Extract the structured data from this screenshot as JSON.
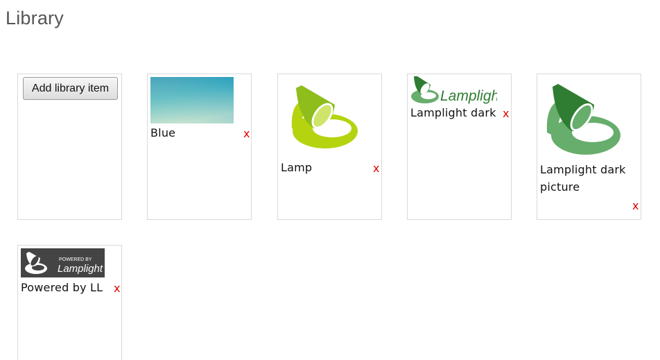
{
  "title": "Library",
  "add_button_label": "Add library item",
  "items": [
    {
      "label": "Blue",
      "image": "blue-gradient-thumbnail"
    },
    {
      "label": "Lamp",
      "image": "lime-lamp-logo"
    },
    {
      "label": "Lamplight dark",
      "image": "lamplight-wordmark-logo",
      "wordmark": "Lamplight"
    },
    {
      "label": "Lamplight dark picture",
      "image": "green-lamp-logo"
    },
    {
      "label": "Powered by LL",
      "image": "powered-by-lamplight-badge",
      "badge_small": "POWERED BY",
      "badge_word": "Lamplight"
    }
  ],
  "remove_label": "x",
  "colors": {
    "remove": "#e00000",
    "lamp_lime": "#b5d30f",
    "lamp_dark_green": "#2f7d32",
    "lamp_light_green": "#67ad6c",
    "badge_bg": "#444444",
    "blue_top": "#1b8fb3",
    "blue_bottom": "#b9ddd1"
  }
}
